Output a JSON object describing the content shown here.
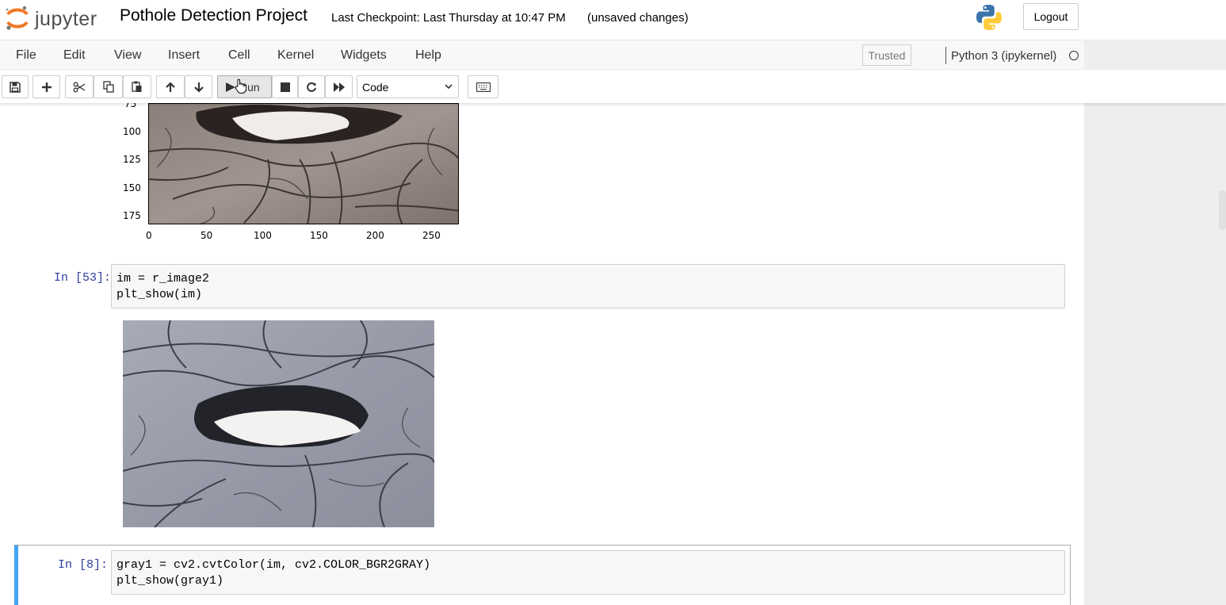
{
  "header": {
    "logo_text": "jupyter",
    "notebook_title": "Pothole Detection Project",
    "checkpoint": "Last Checkpoint: Last Thursday at 10:47 PM",
    "unsaved": "(unsaved changes)",
    "logout_label": "Logout"
  },
  "menu": {
    "items": [
      "File",
      "Edit",
      "View",
      "Insert",
      "Cell",
      "Kernel",
      "Widgets",
      "Help"
    ],
    "trusted": "Trusted",
    "kernel_name": "Python 3 (ipykernel)"
  },
  "toolbar": {
    "run_label": "Run",
    "cell_type": "Code",
    "buttons": [
      "save-icon",
      "plus-icon",
      "scissors-icon",
      "copy-icon",
      "paste-icon",
      "arrow-up-icon",
      "arrow-down-icon",
      "play-icon",
      "stop-icon",
      "restart-icon",
      "fast-forward-icon",
      "keyboard-icon"
    ]
  },
  "plot_axes": {
    "y_ticks": [
      "75",
      "100",
      "125",
      "150",
      "175"
    ],
    "x_ticks": [
      "0",
      "50",
      "100",
      "150",
      "200",
      "250"
    ]
  },
  "cells": [
    {
      "prompt": "In [53]:",
      "code_line1": "im = r_image2",
      "code_line2": "plt_show(im)"
    },
    {
      "prompt": "In [8]:",
      "code_line1": "gray1 = cv2.cvtColor(im, cv2.COLOR_BGR2GRAY)",
      "code_line2": "plt_show(gray1)"
    }
  ],
  "colors": {
    "prompt": "#303f9f",
    "selected_border": "#42a5f5",
    "keyword": "#aa22ff"
  }
}
